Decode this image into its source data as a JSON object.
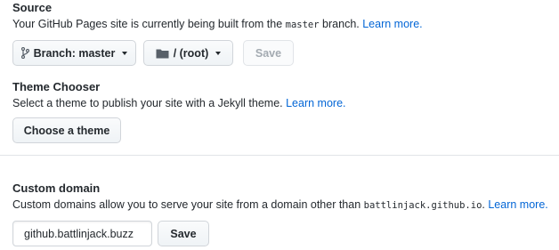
{
  "source": {
    "heading": "Source",
    "desc_prefix": "Your GitHub Pages site is currently being built from the ",
    "branch_code": "master",
    "desc_suffix": " branch. ",
    "learn_more": "Learn more.",
    "branch_button": "Branch: master",
    "folder_button": "/ (root)",
    "save_button": "Save"
  },
  "theme": {
    "heading": "Theme Chooser",
    "desc": "Select a theme to publish your site with a Jekyll theme. ",
    "learn_more": "Learn more.",
    "choose_button": "Choose a theme"
  },
  "custom_domain": {
    "heading": "Custom domain",
    "desc_prefix": "Custom domains allow you to serve your site from a domain other than ",
    "domain_code": "battlinjack.github.io",
    "desc_suffix": ". ",
    "learn_more": "Learn more.",
    "input_value": "github.battlinjack.buzz",
    "save_button": "Save"
  },
  "icons": {
    "branch": "git-branch-icon",
    "folder": "folder-icon"
  }
}
